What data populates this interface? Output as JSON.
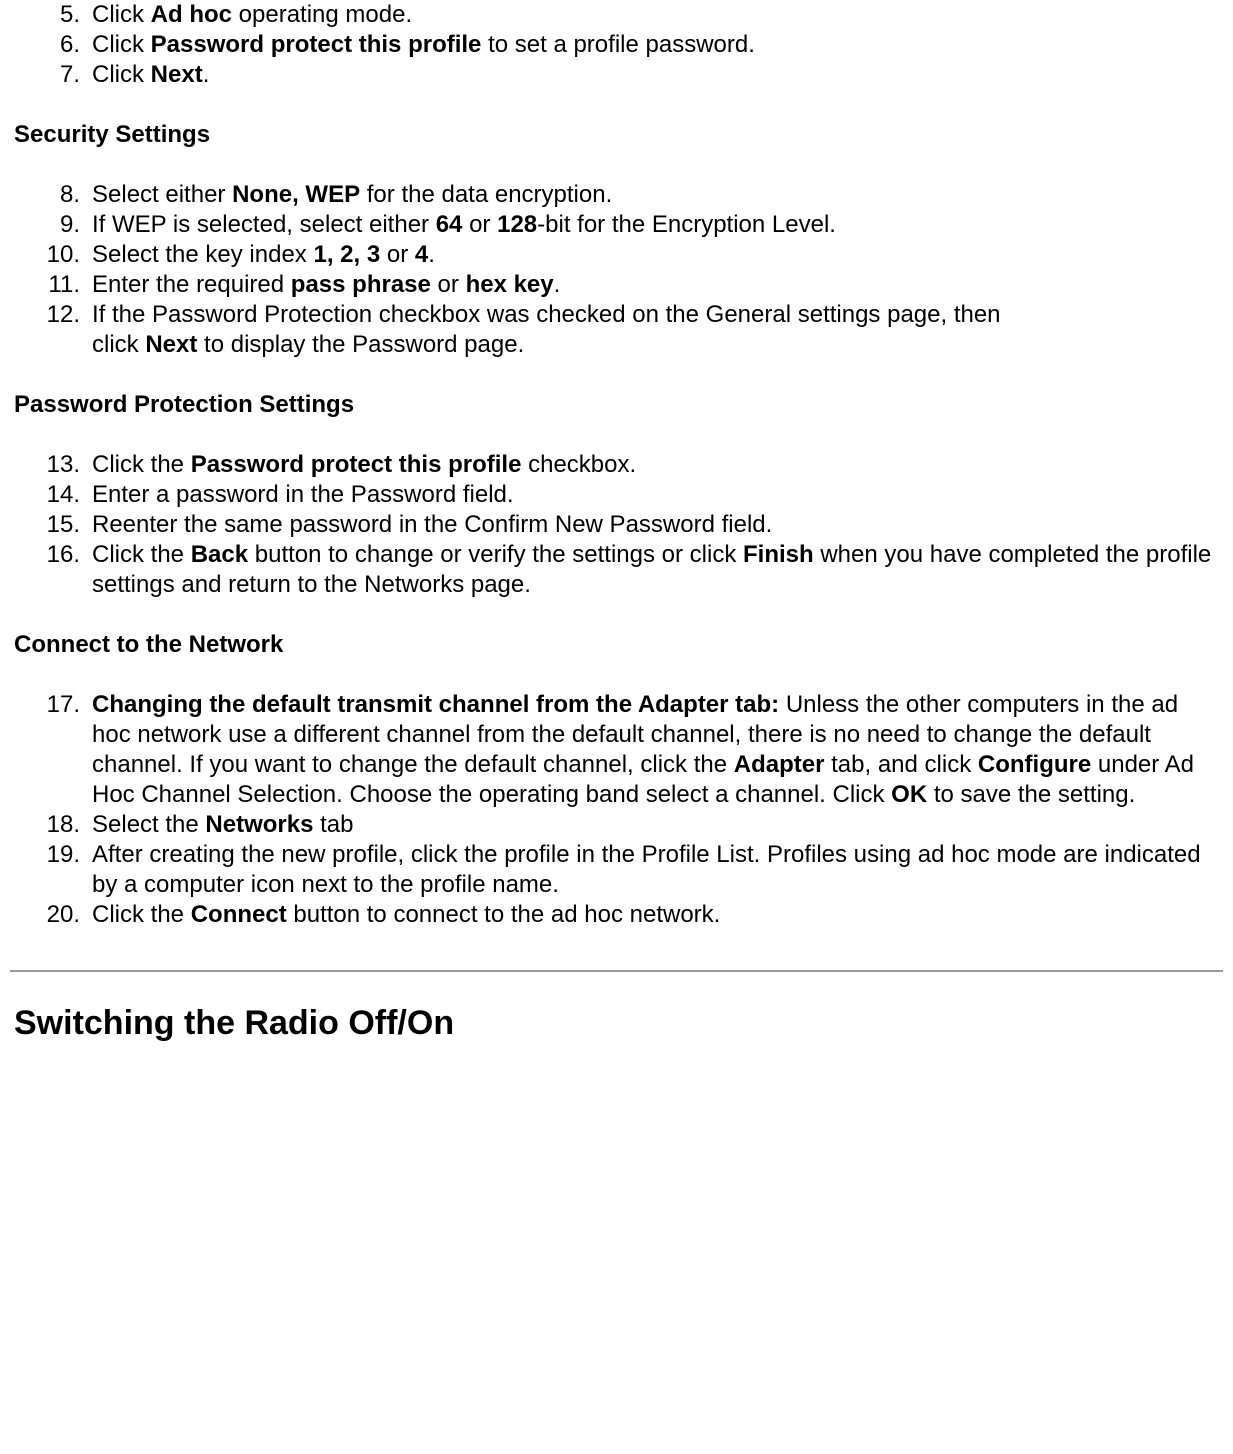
{
  "list1": {
    "item5": {
      "num": "5.",
      "pre": "Click ",
      "b1": "Ad hoc",
      "post": " operating mode."
    },
    "item6": {
      "num": "6.",
      "pre": "Click ",
      "b1": "Password protect this profile",
      "post": " to set a profile password."
    },
    "item7": {
      "num": "7.",
      "pre": "Click ",
      "b1": "Next",
      "post": "."
    }
  },
  "heading_security": "Security Settings",
  "list2": {
    "item8": {
      "num": "8.",
      "pre": "Select either ",
      "b1": "None, WEP",
      "post": " for the data encryption."
    },
    "item9": {
      "num": "9.",
      "pre": "If WEP is selected, select either ",
      "b1": "64",
      "mid": " or ",
      "b2": "128",
      "post": "-bit for the Encryption Level."
    },
    "item10": {
      "num": "10.",
      "pre": "Select the key index ",
      "b1": "1, 2, 3",
      "mid": " or ",
      "b2": "4",
      "post": "."
    },
    "item11": {
      "num": "11.",
      "pre": "Enter the required ",
      "b1": "pass phrase",
      "mid": " or ",
      "b2": "hex key",
      "post": "."
    },
    "item12": {
      "num": "12.",
      "line1": "If the Password Protection checkbox was checked on the General settings page, then",
      "line2_pre": "click ",
      "line2_b": "Next",
      "line2_post": " to display the Password page."
    }
  },
  "heading_password": "Password Protection Settings",
  "list3": {
    "item13": {
      "num": "13.",
      "pre": "Click the ",
      "b1": "Password protect this profile",
      "post": " checkbox."
    },
    "item14": {
      "num": "14.",
      "text": "Enter a password in the Password field."
    },
    "item15": {
      "num": "15.",
      "text": "Reenter the same password in the Confirm New Password field."
    },
    "item16": {
      "num": "16.",
      "pre": "Click the ",
      "b1": "Back",
      "mid": " button to change or verify the settings or click ",
      "b2": "Finish",
      "post": " when you have completed the profile settings and return to the Networks page."
    }
  },
  "heading_connect": "Connect to the Network",
  "list4": {
    "item17": {
      "num": "17.",
      "b1": "Changing the default transmit channel from the Adapter tab:",
      "t1": " Unless the other computers in the ad hoc network use a different channel from the default channel, there is no need to change the default channel. If you want to change the default channel, click the ",
      "b2": "Adapter",
      "t2": " tab, and click ",
      "b3": "Configure",
      "t3": " under Ad Hoc Channel Selection. Choose the operating band select a channel. Click ",
      "b4": "OK",
      "t4": " to save the setting."
    },
    "item18": {
      "num": "18.",
      "pre": "Select the ",
      "b1": "Networks",
      "post": " tab"
    },
    "item19": {
      "num": "19.",
      "text": "After creating the new profile, click the profile in the Profile List. Profiles using ad hoc mode are indicated by a computer icon next to the profile name."
    },
    "item20": {
      "num": "20.",
      "pre": "Click the ",
      "b1": "Connect",
      "post": " button to connect to the ad hoc network."
    }
  },
  "heading_radio": "Switching the Radio Off/On"
}
